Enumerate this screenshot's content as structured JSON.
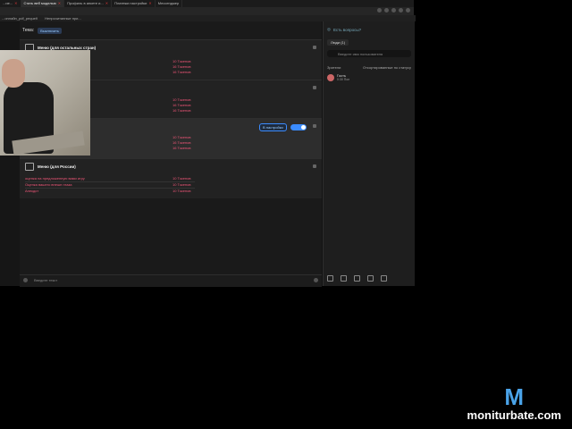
{
  "tabs": [
    {
      "label": "...ие...",
      "active": false
    },
    {
      "label": "Стать веб моделью",
      "active": true
    },
    {
      "label": "Профиль в анкете и...",
      "active": false
    },
    {
      "label": "Платежи настройки",
      "active": false
    },
    {
      "label": "Мессенджер",
      "active": false
    }
  ],
  "bookmarks": [
    "...онлайн_pdf_pequeñ",
    "Непрочитанные при..."
  ],
  "toolbar": {
    "label": "Тема:",
    "pill": "Выключить"
  },
  "menus": [
    {
      "title": "Меню (для остальных стран)",
      "rows": [
        [
          "",
          "10 Токенов"
        ],
        [
          "",
          "16 Токенов"
        ],
        [
          "",
          "16 Токенов"
        ]
      ]
    },
    {
      "title": "",
      "rows": [
        [
          "",
          "10 Токенов"
        ],
        [
          "",
          "16 Токенов"
        ],
        [
          "",
          "16 Токенов"
        ]
      ]
    },
    {
      "title": "",
      "rows": [
        [
          "",
          "10 Токенов"
        ],
        [
          "",
          "16 Токенов"
        ],
        [
          "",
          "16 Токенов"
        ]
      ],
      "chip": "В настройки",
      "toggle": "ON"
    },
    {
      "title": "Меню (для России)",
      "rows": [
        [
          "оценка на предложенную вами игру",
          "10 Токенов"
        ],
        [
          "Оценка вашего внешн глаза",
          "10 Токенов"
        ],
        [
          "Анекдот",
          "10 Токенов"
        ]
      ]
    }
  ],
  "chat": {
    "placeholder": "Введите текст"
  },
  "sidebar": {
    "top_link": "Есть вопросы?",
    "tab_people": "Люди (1)",
    "search_placeholder": "Введите имя пользователя",
    "header_left": "Зрители",
    "header_right": "Отсортированные по статусу",
    "user": {
      "name": "Гость",
      "sub": "0:30 Пол"
    }
  },
  "watermark": {
    "logo": "M",
    "text": "moniturbate.com"
  },
  "colors": {
    "accent": "#3b8cff",
    "token": "#e55577"
  }
}
